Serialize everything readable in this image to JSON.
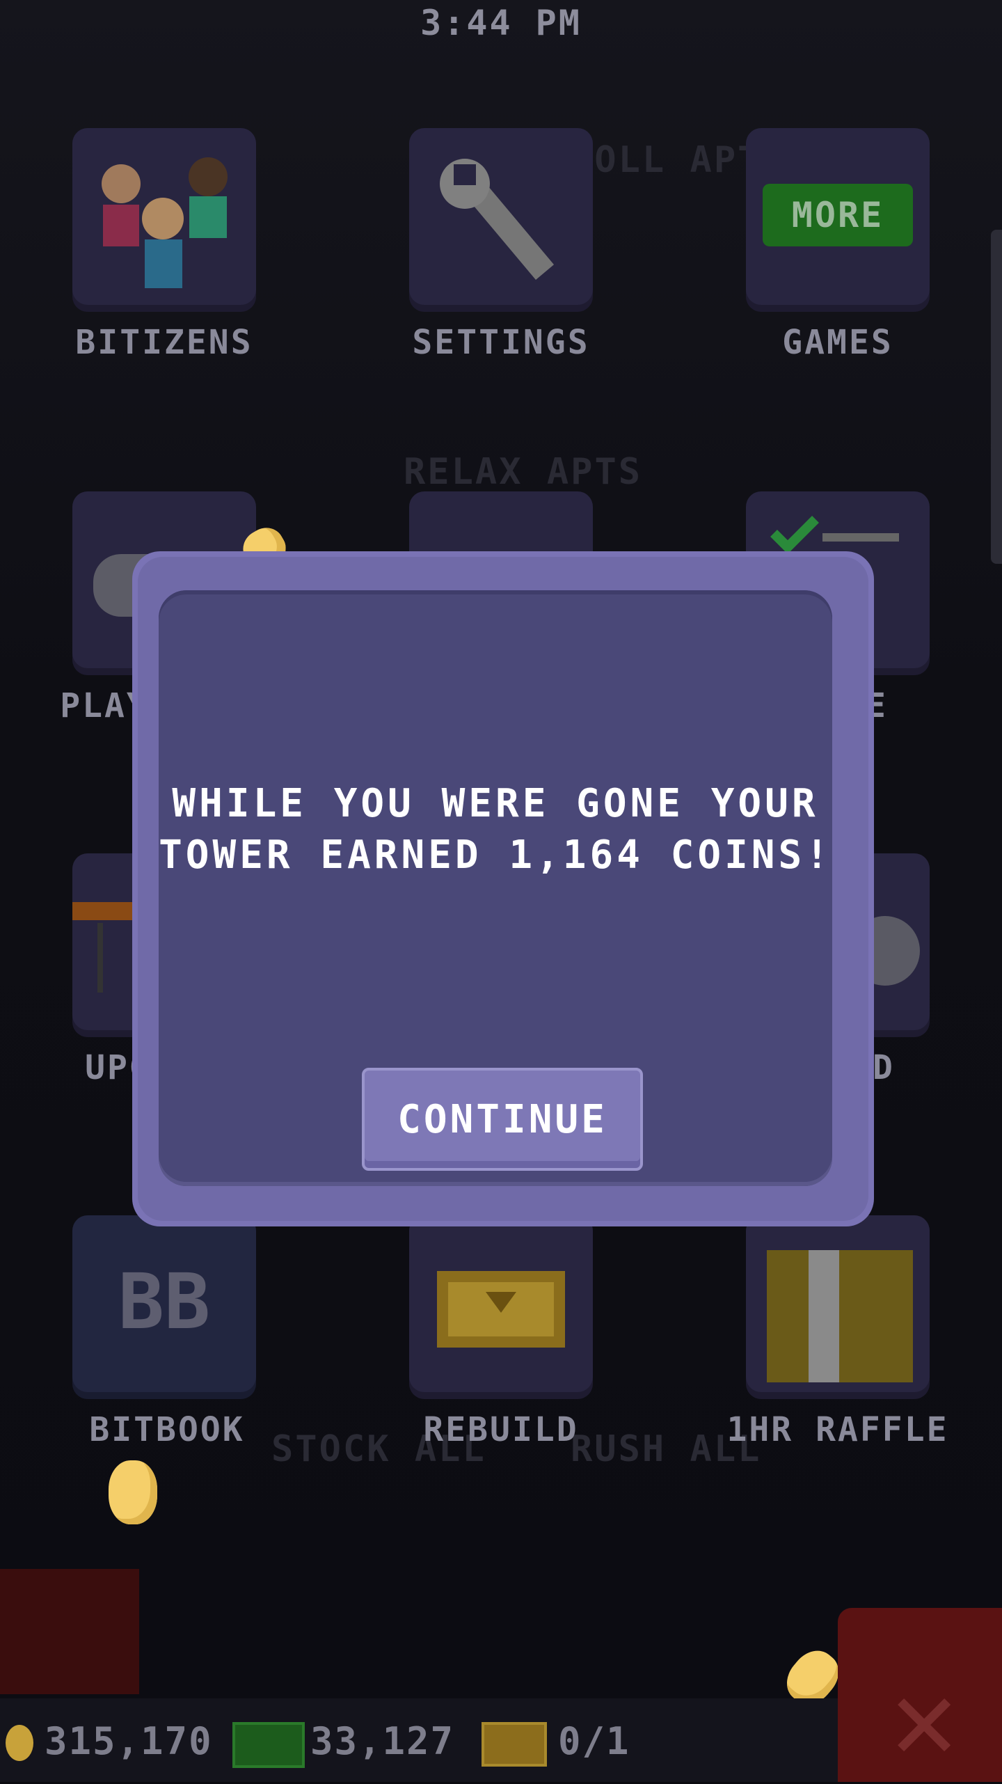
{
  "status_bar": {
    "time": "3:44 PM"
  },
  "background_hints": {
    "floor_1": "ROLL APTS",
    "floor_2": "RELAX APTS",
    "stock_all": "STOCK ALL",
    "rush_all": "RUSH ALL"
  },
  "menu": {
    "row1": [
      {
        "label": "BITIZENS",
        "icon": "people-icon"
      },
      {
        "label": "SETTINGS",
        "icon": "wrench-icon"
      },
      {
        "label": "GAMES",
        "icon": "more-icon",
        "badge": "MORE"
      }
    ],
    "row2": [
      {
        "label": "PLAY",
        "icon": "gamepad-icon"
      },
      {
        "label": "",
        "icon": "elevator-icon"
      },
      {
        "label": "E",
        "icon": "checklist-icon"
      }
    ],
    "row3": [
      {
        "label": "UPG",
        "icon": "upgrade-icon"
      },
      {
        "label": "",
        "icon": ""
      },
      {
        "label": "D",
        "icon": "cloud-icon"
      }
    ],
    "row4": [
      {
        "label": "BITBOOK",
        "icon": "bitbook-icon",
        "glyph": "BB"
      },
      {
        "label": "REBUILD",
        "icon": "rebuild-icon"
      },
      {
        "label": "1HR RAFFLE",
        "icon": "raffle-icon"
      }
    ]
  },
  "modal": {
    "message_line1": "WHILE YOU WERE GONE YOUR",
    "message_line2": "TOWER EARNED 1,164 COINS!",
    "continue_label": "CONTINUE"
  },
  "bottom_bar": {
    "coins": "315,170",
    "bux": "33,127",
    "tickets": "0/1"
  },
  "colors": {
    "modal_frame": "#706aa8",
    "modal_body": "#4a4878",
    "continue_button": "#7e78b6",
    "coin": "#f5cf6a",
    "more_button": "#1d6b1d"
  }
}
